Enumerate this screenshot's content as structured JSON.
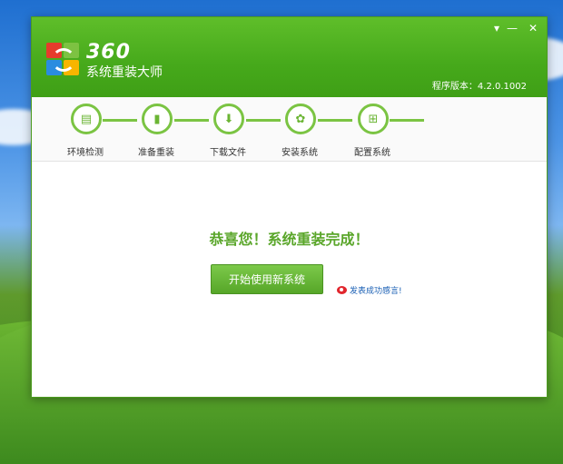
{
  "app": {
    "brand_number": "360",
    "brand_name": "系统重装大师",
    "version": "程序版本：4.2.0.1002"
  },
  "window_controls": {
    "menu_icon": "▾",
    "minimize_icon": "—",
    "close_icon": "✕"
  },
  "steps": [
    {
      "label": "环境检测",
      "icon": "▤"
    },
    {
      "label": "准备重装",
      "icon": "▮"
    },
    {
      "label": "下载文件",
      "icon": "⬇"
    },
    {
      "label": "安装系统",
      "icon": "✿"
    },
    {
      "label": "配置系统",
      "icon": "⊞"
    }
  ],
  "main": {
    "message": "恭喜您！系统重装完成！",
    "start_button": "开始使用新系统",
    "share_link": "发表成功感言!"
  },
  "colors": {
    "header_green": "#4fb021",
    "accent_green": "#7bc443",
    "message_green": "#5aa62a"
  }
}
